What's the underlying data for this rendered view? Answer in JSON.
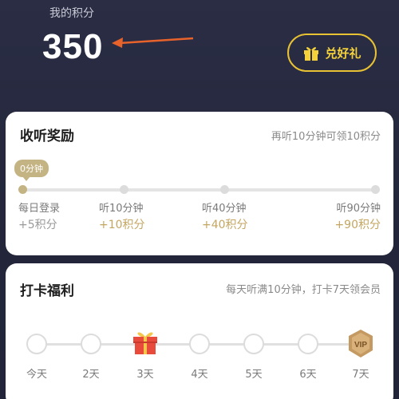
{
  "header": {
    "label": "我的积分",
    "points": "350",
    "redeem_label": "兑好礼"
  },
  "listen": {
    "title": "收听奖励",
    "hint": "再听10分钟可领10积分",
    "bubble": "0分钟",
    "milestones": [
      {
        "label": "每日登录",
        "reward": "+5积分"
      },
      {
        "label": "听10分钟",
        "reward": "+10积分"
      },
      {
        "label": "听40分钟",
        "reward": "+40积分"
      },
      {
        "label": "听90分钟",
        "reward": "+90积分"
      }
    ]
  },
  "checkin": {
    "title": "打卡福利",
    "hint": "每天听满10分钟，打卡7天领会员",
    "days": [
      "今天",
      "2天",
      "3天",
      "4天",
      "5天",
      "6天",
      "7天"
    ],
    "vip_label": "VIP"
  },
  "colors": {
    "accent_gold": "#e8c233",
    "progress_gold": "#c4b484",
    "reward_gold": "#c4a661",
    "arrow": "#e8632b",
    "gift_red": "#e84b3c"
  }
}
